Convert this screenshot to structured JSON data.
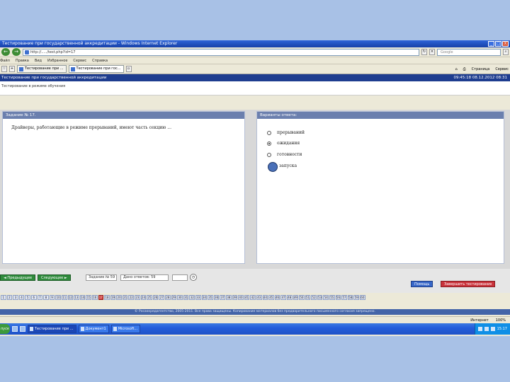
{
  "window": {
    "title": "Тестирование при государственной аккредитации - Windows Internet Explorer",
    "controls": [
      "_",
      "□",
      "X"
    ]
  },
  "address_bar": {
    "back": "←",
    "forward": "→",
    "url": "http://...../test.php?id=17",
    "search_placeholder": "Google"
  },
  "menu": [
    "Файл",
    "Правка",
    "Вид",
    "Избранное",
    "Сервис",
    "Справка"
  ],
  "tabs": [
    {
      "label": "Тестирование при ..."
    },
    {
      "label": "Тестирование при гос..."
    }
  ],
  "tabs_right": [
    "Страница",
    "Сервис"
  ],
  "app_header": {
    "title": "Тестирование при государственной аккредитации",
    "datetime": "09:45:18 08.12.2012 08:31"
  },
  "subheader": "Тестирование в режиме обучения",
  "question_panel": {
    "heading": "Задание № 17.",
    "text": "Драйверы, работающие в режиме прерываний, имеют часть секцию ..."
  },
  "options_panel": {
    "heading": "Варианты ответа:",
    "options": [
      {
        "label": "прерываний",
        "selected": false
      },
      {
        "label": "ожидания",
        "selected": true
      },
      {
        "label": "готовности",
        "selected": false
      },
      {
        "label": "запуска",
        "selected": false
      }
    ]
  },
  "controls": {
    "prev": "◄ Предыдущее",
    "next": "Следующее ►",
    "task_field": "Задание № 59",
    "answered_field": "Дано ответов: 59",
    "clock": "",
    "help": "Помощь",
    "finish": "Завершить тестирование"
  },
  "question_numbers": [
    "1",
    "2",
    "3",
    "4",
    "5",
    "6",
    "7",
    "8",
    "9",
    "10",
    "11",
    "12",
    "13",
    "14",
    "15",
    "16",
    "17",
    "18",
    "19",
    "20",
    "21",
    "22",
    "23",
    "24",
    "25",
    "26",
    "27",
    "28",
    "29",
    "30",
    "31",
    "32",
    "33",
    "34",
    "35",
    "36",
    "37",
    "38",
    "39",
    "40",
    "41",
    "42",
    "43",
    "44",
    "45",
    "46",
    "47",
    "48",
    "49",
    "50",
    "51",
    "52",
    "53",
    "54",
    "55",
    "56",
    "57",
    "58",
    "59",
    "60"
  ],
  "current_question": "17",
  "footer": "© Росаккредагентство, 2005-2011. Все права защищены. Копирование материалов без предварительного письменного согласия запрещено.",
  "statusbar": {
    "zone": "Интернет",
    "zoom": "100%"
  },
  "taskbar": {
    "start": "пуск",
    "tasks": [
      {
        "label": "Тестирование при ...",
        "active": true
      },
      {
        "label": "Документ1",
        "active": false
      },
      {
        "label": "Microsoft...",
        "active": false
      }
    ],
    "clock": "15:17"
  },
  "colors": {
    "desktop": "#a8c1e6",
    "header": "#1e3d8f",
    "panel_head": "#6b7fae",
    "prev_next": "#2f8b3c",
    "help": "#3867c8",
    "finish": "#c9323a",
    "current_q": "#d33a3a"
  }
}
